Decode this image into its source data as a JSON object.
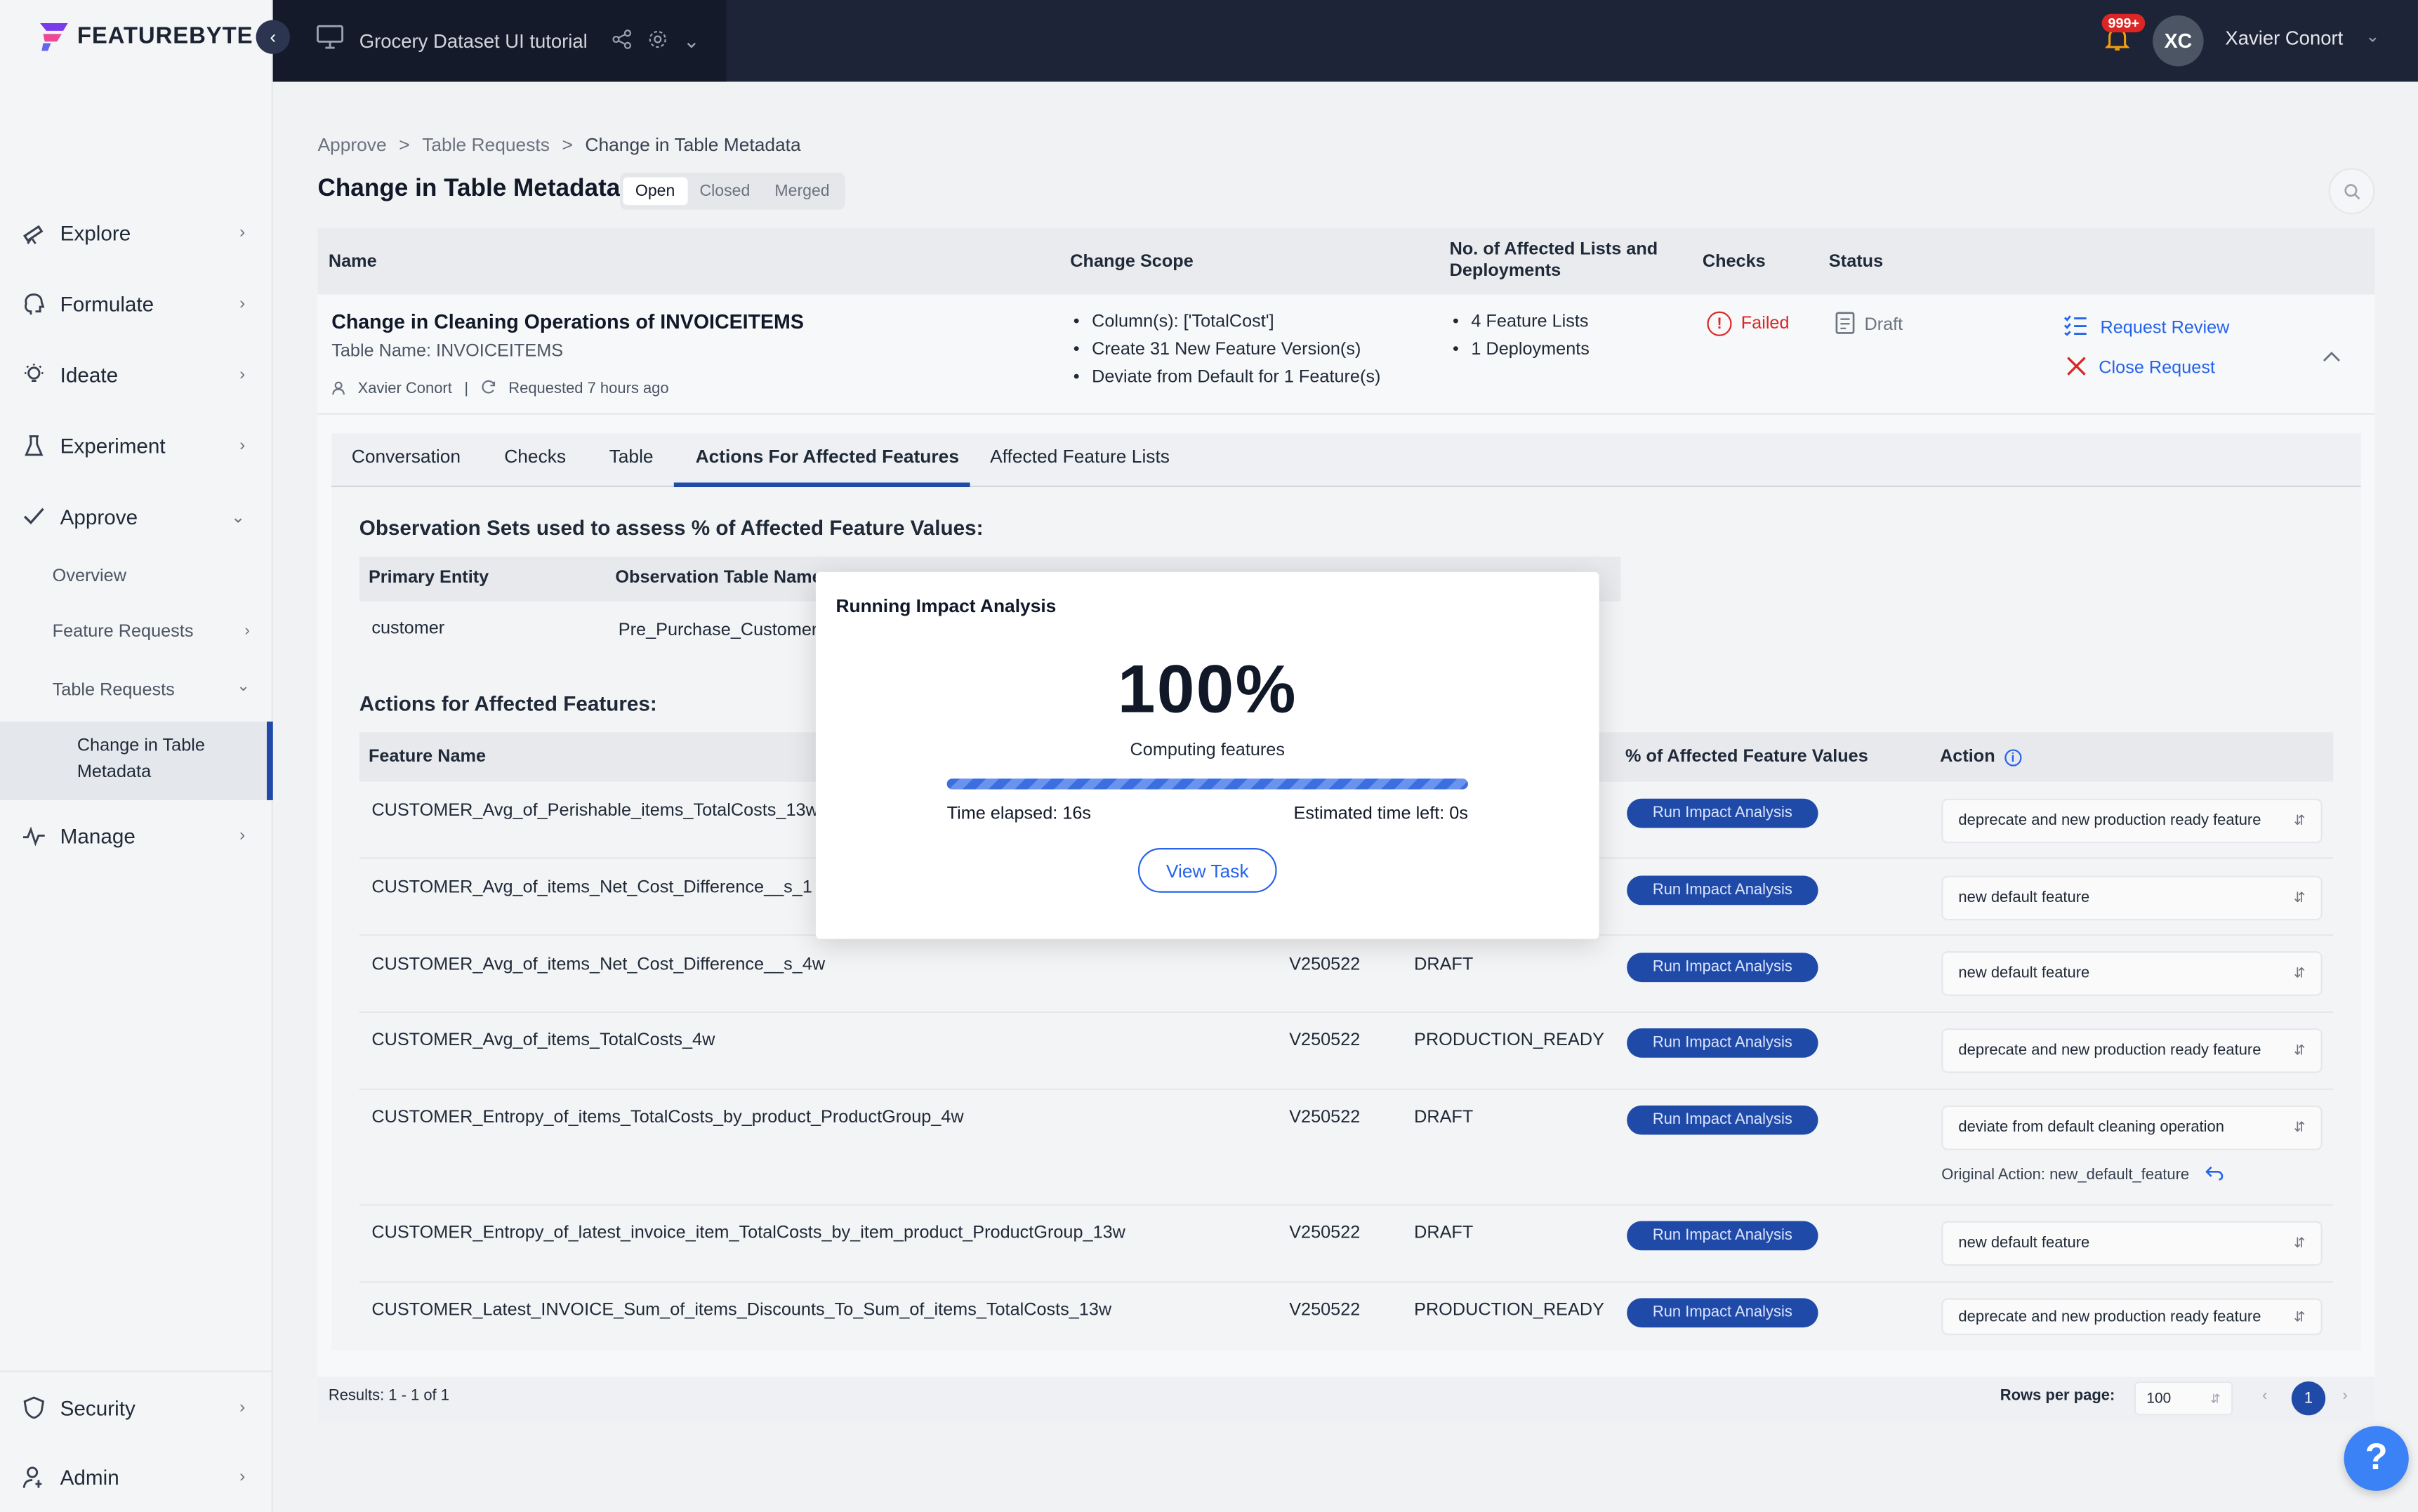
{
  "brand": {
    "name": "FEATUREBYTE"
  },
  "topbar": {
    "project_name": "Grocery Dataset UI tutorial",
    "notifications": "999+",
    "user_initials": "XC",
    "user_name": "Xavier Conort"
  },
  "sidebar": {
    "items": [
      {
        "label": "Explore",
        "icon": "telescope-icon"
      },
      {
        "label": "Formulate",
        "icon": "brain-icon"
      },
      {
        "label": "Ideate",
        "icon": "lightbulb-icon"
      },
      {
        "label": "Experiment",
        "icon": "flask-icon"
      },
      {
        "label": "Approve",
        "icon": "check-icon"
      },
      {
        "label": "Manage",
        "icon": "pulse-icon"
      }
    ],
    "approve_sub": {
      "overview": "Overview",
      "feature_requests": "Feature Requests",
      "table_requests": "Table Requests",
      "active": "Change in Table Metadata"
    },
    "bottom": [
      {
        "label": "Security",
        "icon": "shield-icon"
      },
      {
        "label": "Admin",
        "icon": "user-gear-icon"
      }
    ]
  },
  "breadcrumb": [
    "Approve",
    "Table Requests",
    "Change in Table Metadata"
  ],
  "page": {
    "title": "Change in Table Metadata",
    "filters": [
      "Open",
      "Closed",
      "Merged"
    ],
    "active_filter": "Open"
  },
  "requests_table": {
    "headers": {
      "name": "Name",
      "scope": "Change Scope",
      "affected": "No. of Affected Lists and Deployments",
      "checks": "Checks",
      "status": "Status"
    },
    "row": {
      "name": "Change in Cleaning Operations of INVOICEITEMS",
      "table_name": "Table Name: INVOICEITEMS",
      "author": "Xavier Conort",
      "requested": "Requested 7 hours ago",
      "scope": [
        "Column(s): ['TotalCost']",
        "Create 31 New Feature Version(s)",
        "Deviate from Default for 1 Feature(s)"
      ],
      "affected": [
        "4 Feature Lists",
        "1 Deployments"
      ],
      "checks": "Failed",
      "status": "Draft",
      "action_review": "Request Review",
      "action_close": "Close Request"
    }
  },
  "tabs": [
    "Conversation",
    "Checks",
    "Table",
    "Actions For Affected Features",
    "Affected Feature Lists"
  ],
  "active_tab": "Actions For Affected Features",
  "observation": {
    "title": "Observation Sets used to assess % of Affected Feature Values:",
    "headers": [
      "Primary Entity",
      "Observation Table Name"
    ],
    "row": [
      "customer",
      "Pre_Purchase_Customer"
    ]
  },
  "features": {
    "title": "Actions for Affected Features:",
    "headers": {
      "name": "Feature Name",
      "pct": "% of Affected Feature Values",
      "action": "Action"
    },
    "run_label": "Run Impact Analysis",
    "original_action": "Original Action: new_default_feature",
    "rows": [
      {
        "name": "CUSTOMER_Avg_of_Perishable_items_TotalCosts_13w",
        "version": "",
        "status": "",
        "action": "deprecate and new production ready feature"
      },
      {
        "name": "CUSTOMER_Avg_of_items_Net_Cost_Difference__s_1",
        "version": "",
        "status": "",
        "action": "new default feature"
      },
      {
        "name": "CUSTOMER_Avg_of_items_Net_Cost_Difference__s_4w",
        "version": "V250522",
        "status": "DRAFT",
        "action": "new default feature"
      },
      {
        "name": "CUSTOMER_Avg_of_items_TotalCosts_4w",
        "version": "V250522",
        "status": "PRODUCTION_READY",
        "action": "deprecate and new production ready feature"
      },
      {
        "name": "CUSTOMER_Entropy_of_items_TotalCosts_by_product_ProductGroup_4w",
        "version": "V250522",
        "status": "DRAFT",
        "action": "deviate from default cleaning operation"
      },
      {
        "name": "CUSTOMER_Entropy_of_latest_invoice_item_TotalCosts_by_item_product_ProductGroup_13w",
        "version": "V250522",
        "status": "DRAFT",
        "action": "new default feature"
      },
      {
        "name": "CUSTOMER_Latest_INVOICE_Sum_of_items_Discounts_To_Sum_of_items_TotalCosts_13w",
        "version": "V250522",
        "status": "PRODUCTION_READY",
        "action": "deprecate and new production ready feature"
      }
    ]
  },
  "footer": {
    "results": "Results: 1 - 1 of 1",
    "rows_per_page_label": "Rows per page:",
    "rows_per_page": "100",
    "page": "1"
  },
  "modal": {
    "title": "Running Impact Analysis",
    "percent": "100%",
    "progress": 1.0,
    "subtitle": "Computing features",
    "elapsed": "Time elapsed: 16s",
    "remaining": "Estimated time left: 0s",
    "button": "View Task"
  },
  "colors": {
    "accent": "#1f4aa8",
    "link": "#2563eb",
    "danger": "#dc2626",
    "topbar": "#1d2437"
  }
}
